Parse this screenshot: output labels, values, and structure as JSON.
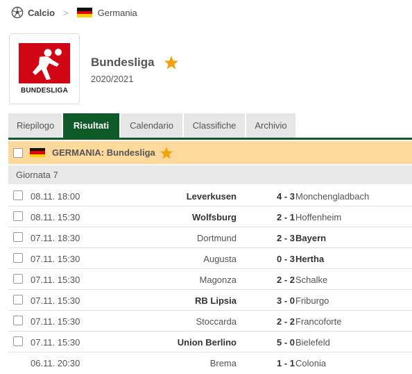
{
  "breadcrumb": {
    "sport": "Calcio",
    "country": "Germania",
    "sport_icon": "soccer-ball-icon",
    "separator": ">"
  },
  "league": {
    "logo_text": "BUNDESLIGA",
    "name": "Bundesliga",
    "season": "2020/2021",
    "star_color": "#f0a30a"
  },
  "tabs": [
    {
      "label": "Riepilogo",
      "active": false
    },
    {
      "label": "Risultati",
      "active": true
    },
    {
      "label": "Calendario",
      "active": false
    },
    {
      "label": "Classifiche",
      "active": false
    },
    {
      "label": "Archivio",
      "active": false
    }
  ],
  "competition": {
    "title": "GERMANIA: Bundesliga"
  },
  "round": "Giornata 7",
  "matches": [
    {
      "time": "08.11. 18:00",
      "home": "Leverkusen",
      "score": "4 - 3",
      "away": "Monchengladbach",
      "winner": "home"
    },
    {
      "time": "08.11. 15:30",
      "home": "Wolfsburg",
      "score": "2 - 1",
      "away": "Hoffenheim",
      "winner": "home"
    },
    {
      "time": "07.11. 18:30",
      "home": "Dortmund",
      "score": "2 - 3",
      "away": "Bayern",
      "winner": "away"
    },
    {
      "time": "07.11. 15:30",
      "home": "Augusta",
      "score": "0 - 3",
      "away": "Hertha",
      "winner": "away"
    },
    {
      "time": "07.11. 15:30",
      "home": "Magonza",
      "score": "2 - 2",
      "away": "Schalke",
      "winner": "draw"
    },
    {
      "time": "07.11. 15:30",
      "home": "RB Lipsia",
      "score": "3 - 0",
      "away": "Friburgo",
      "winner": "home"
    },
    {
      "time": "07.11. 15:30",
      "home": "Stoccarda",
      "score": "2 - 2",
      "away": "Francoforte",
      "winner": "draw"
    },
    {
      "time": "07.11. 15:30",
      "home": "Union Berlino",
      "score": "5 - 0",
      "away": "Bielefeld",
      "winner": "home"
    },
    {
      "time": "06.11. 20:30",
      "home": "Brema",
      "score": "1 - 1",
      "away": "Colonia",
      "winner": "draw"
    }
  ],
  "colors": {
    "tab_active": "#0f5b27",
    "competition_bar": "#fbd99a",
    "logo_red": "#d20515"
  }
}
